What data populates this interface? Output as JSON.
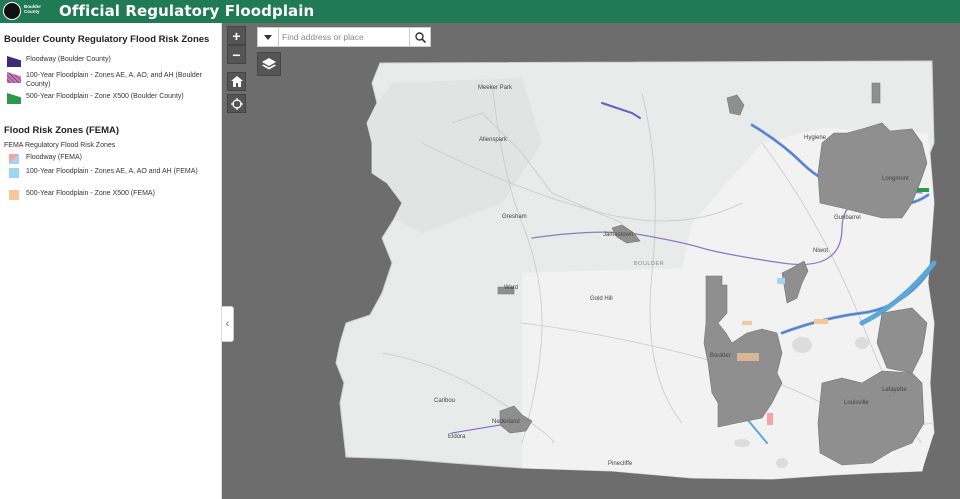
{
  "header": {
    "logo_text": "Boulder County",
    "title": "Official Regulatory Floodplain"
  },
  "legend": {
    "section1_title": "Boulder County Regulatory Flood Risk Zones",
    "section1_items": [
      {
        "label": "Floodway (Boulder County)",
        "color": "#3d2a7a"
      },
      {
        "label": "100-Year Floodplain - Zones AE, A, AO, and AH (Boulder County)",
        "color": "#c47ab8"
      },
      {
        "label": "500-Year Floodplain - Zone X500 (Boulder County)",
        "color": "#2a9a4a"
      }
    ],
    "section2_title": "Flood Risk Zones (FEMA)",
    "section2_subtitle": "FEMA Regulatory Flood Risk Zones",
    "section2_items": [
      {
        "label": "Floodway (FEMA)",
        "color": "#f5a3a3"
      },
      {
        "label": "100-Year Floodplain - Zones AE, A, AO and AH (FEMA)",
        "color": "#9fd4f5"
      },
      {
        "label": "500-Year Floodplain - Zone X500 (FEMA)",
        "color": "#f7c79a"
      }
    ]
  },
  "search": {
    "placeholder": "Find address or place"
  },
  "map_controls": {
    "zoom_in": "+",
    "zoom_out": "−"
  },
  "places": {
    "meeker_park": "Meeker Park",
    "allenspark": "Allenspark",
    "hygiene": "Hygiene",
    "gresham": "Gresham",
    "jamestown": "Jamestown",
    "boulder_region": "BOULDER",
    "ward": "Ward",
    "gold_hill": "Gold Hill",
    "niwot": "Niwot",
    "boulder": "Boulder",
    "caribou": "Caribou",
    "nederland": "Nederland",
    "eldora": "Eldora",
    "louisville": "Louisville",
    "lafayette": "Lafayette",
    "longmont": "Longmont",
    "gunbarrel": "Gunbarrel",
    "pinecliffe": "Pinecliffe"
  }
}
